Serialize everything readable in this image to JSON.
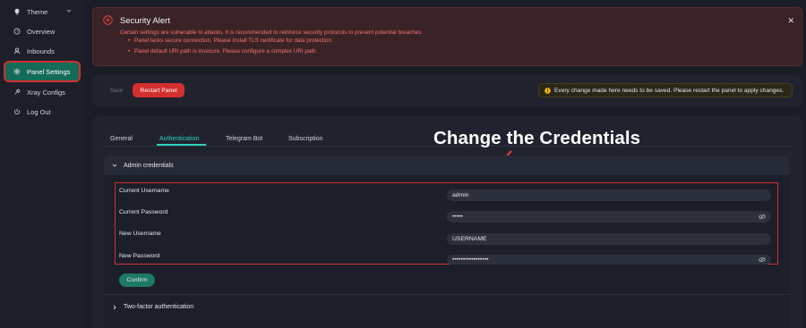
{
  "sidebar": {
    "items": [
      {
        "label": "Theme",
        "icon": "bulb-icon"
      },
      {
        "label": "Overview",
        "icon": "dashboard-icon"
      },
      {
        "label": "Inbounds",
        "icon": "user-icon"
      },
      {
        "label": "Panel Settings",
        "icon": "gear-icon"
      },
      {
        "label": "Xray Configs",
        "icon": "tool-icon"
      },
      {
        "label": "Log Out",
        "icon": "logout-icon"
      }
    ],
    "active": "Panel Settings"
  },
  "alert": {
    "title": "Security Alert",
    "message": "Certain settings are vulnerable to attacks. It is recommended to reinforce security protocols to prevent potential breaches.",
    "items": [
      "Panel lacks secure connection. Please install TLS certificate for data protection.",
      "Panel default URI path is insecure. Please configure a complex URI path."
    ]
  },
  "actions": {
    "save_label": "Save",
    "restart_label": "Restart Panel",
    "note": "Every change made here needs to be saved. Please restart the panel to apply changes."
  },
  "tabs": [
    {
      "label": "General"
    },
    {
      "label": "Authentication",
      "active": true
    },
    {
      "label": "Telegram Bot"
    },
    {
      "label": "Subscription"
    }
  ],
  "annotation": {
    "headline": "Change the Credentials"
  },
  "admin_section": {
    "title": "Admin credentials",
    "fields": [
      {
        "label": "Current Username",
        "value": "admin",
        "type": "text"
      },
      {
        "label": "Current Password",
        "value": "•••••",
        "type": "password"
      },
      {
        "label": "New Username",
        "value": "USERNAME",
        "type": "text"
      },
      {
        "label": "New Password",
        "value": "•••••••••••••••••",
        "type": "password"
      }
    ],
    "confirm_label": "Confirm"
  },
  "two_factor_section": {
    "title": "Two-factor authentication"
  },
  "colors": {
    "accent": "#2dd4bf",
    "danger": "#d32f2f",
    "active_nav": "#146b58"
  }
}
